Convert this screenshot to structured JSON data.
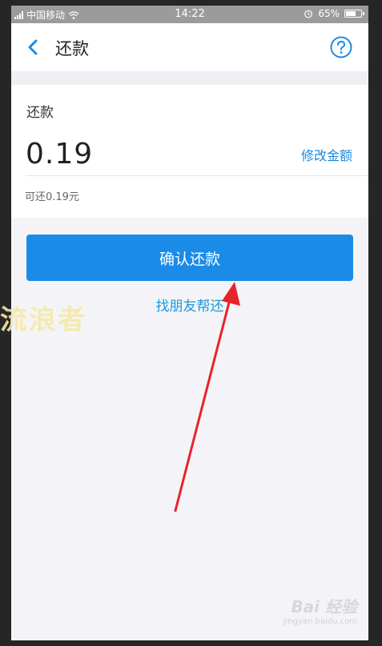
{
  "status_bar": {
    "carrier": "中国移动",
    "time": "14:22",
    "battery": "65%",
    "battery_level": 0.65,
    "icons": [
      "signal-icon",
      "wifi-icon",
      "alarm-icon",
      "battery-icon"
    ]
  },
  "header": {
    "title": "还款",
    "back_icon": "chevron-left-icon",
    "help_icon": "question-circle-icon"
  },
  "amount_section": {
    "label": "还款",
    "amount": "0.19",
    "modify_label": "修改金额",
    "available": "可还0.19元"
  },
  "actions": {
    "confirm_label": "确认还款",
    "friend_label": "找朋友帮还"
  },
  "watermarks": {
    "text": "流浪者",
    "baidu_logo": "Bai 经验",
    "baidu_url": "jingyan.baidu.com"
  },
  "colors": {
    "accent": "#1a8ce8",
    "link": "#1a9ad8",
    "annotation_arrow": "#e8232b"
  }
}
